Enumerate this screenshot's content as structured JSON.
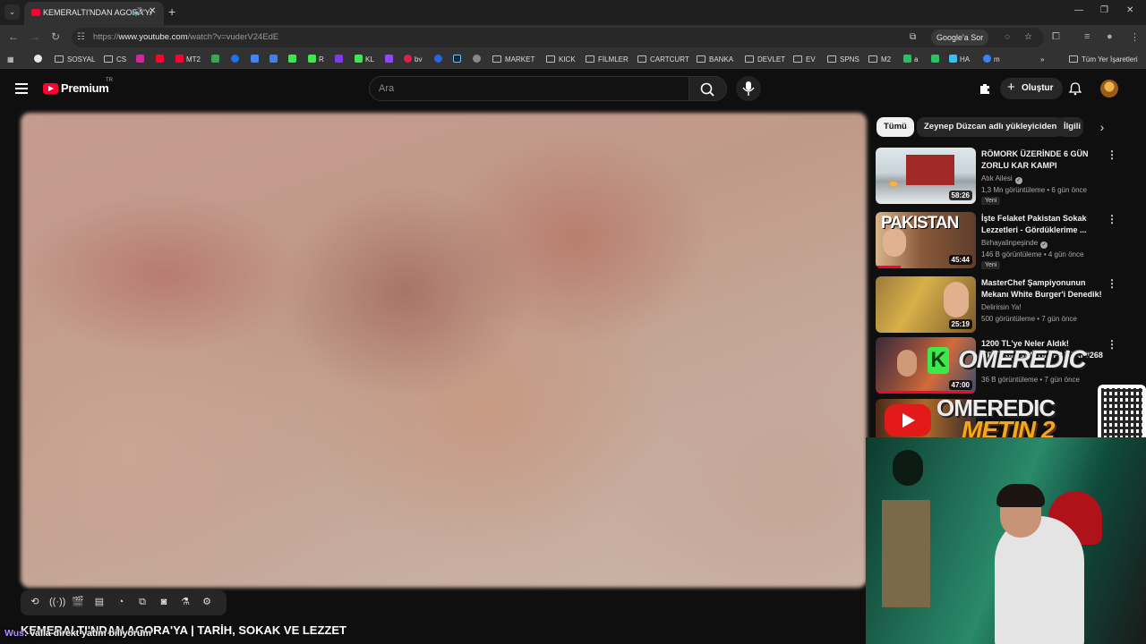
{
  "browser": {
    "tab_title": "KEMERALTI'NDAN AGORA'YA | TARİH, SOKAK VE LEZZET - YouTube",
    "url_prefix": "https://",
    "url_host": "www.youtube.com",
    "url_path": "/watch?v=vuderV24EdE",
    "google_button": "Google'a Sor"
  },
  "bookmarks": {
    "sosyal": "SOSYAL",
    "cs": "CS",
    "mt2": "MT2",
    "r": "R",
    "kl": "KL",
    "bv": "bv",
    "market": "MARKET",
    "kick": "KICK",
    "filmler": "FİLMLER",
    "cartcurt": "CARTCURT",
    "banka": "BANKA",
    "devlet": "DEVLET",
    "ev": "EV",
    "spns": "SPNS",
    "m2": "M2",
    "a": "a",
    "ha": "HA",
    "m": "m",
    "all_bookmarks": "Tüm Yer İşaretleri"
  },
  "youtube": {
    "logo_text": "Premium",
    "logo_country": "TR",
    "search_placeholder": "Ara",
    "create_label": "Oluştur"
  },
  "video": {
    "title": "KEMERALTI'NDAN AGORA'YA | TARİH, SOKAK VE LEZZET"
  },
  "chat": {
    "user": "Wus",
    "message": "valla direkt yatım biliyorum"
  },
  "chips": [
    "Tümü",
    "Zeynep Düzcan adlı yükleyiciden",
    "İlgili"
  ],
  "recommendations": [
    {
      "title": "RÖMORK ÜZERİNDE 6 GÜN ZORLU KAR KAMPI",
      "channel": "Atık Ailesi",
      "verified": true,
      "meta": "1,3 Mn görüntüleme • 6 gün önce",
      "badge": "Yeni",
      "duration": "58:26"
    },
    {
      "title": "İşte Felaket Pakistan Sokak Lezzetleri - Gördüklerime ...",
      "channel": "Birhayalinpeşinde",
      "verified": true,
      "meta": "146 B görüntüleme • 4 gün önce",
      "badge": "Yeni",
      "duration": "45:44",
      "thumb_text": "PAKISTAN"
    },
    {
      "title": "MasterChef Şampiyonunun Mekanı White Burger'i Denedik!",
      "channel": "Delirirsin Ya!",
      "verified": false,
      "meta": "500 görüntüleme • 7 gün önce",
      "badge": "",
      "duration": "25:19"
    },
    {
      "title": "1200 TL'ye Neler Aldık! KEFERIHISAR BİT PAZARI #268",
      "channel": "",
      "verified": false,
      "meta": "36 B görüntüleme • 7 gün önce",
      "badge": "",
      "duration": "47:00"
    },
    {
      "title": "",
      "channel": "",
      "verified": false,
      "meta": "",
      "badge": "",
      "duration": ""
    }
  ],
  "overlay": {
    "kick_letter": "K",
    "kick_name": "OMEREDIC",
    "banner_line1": "OMEREDIC",
    "banner_line2": "METIN 2"
  },
  "colors": {
    "youtube_red": "#ff0033",
    "kick_green": "#3ee84a",
    "page_bg": "#0f0f0f"
  }
}
